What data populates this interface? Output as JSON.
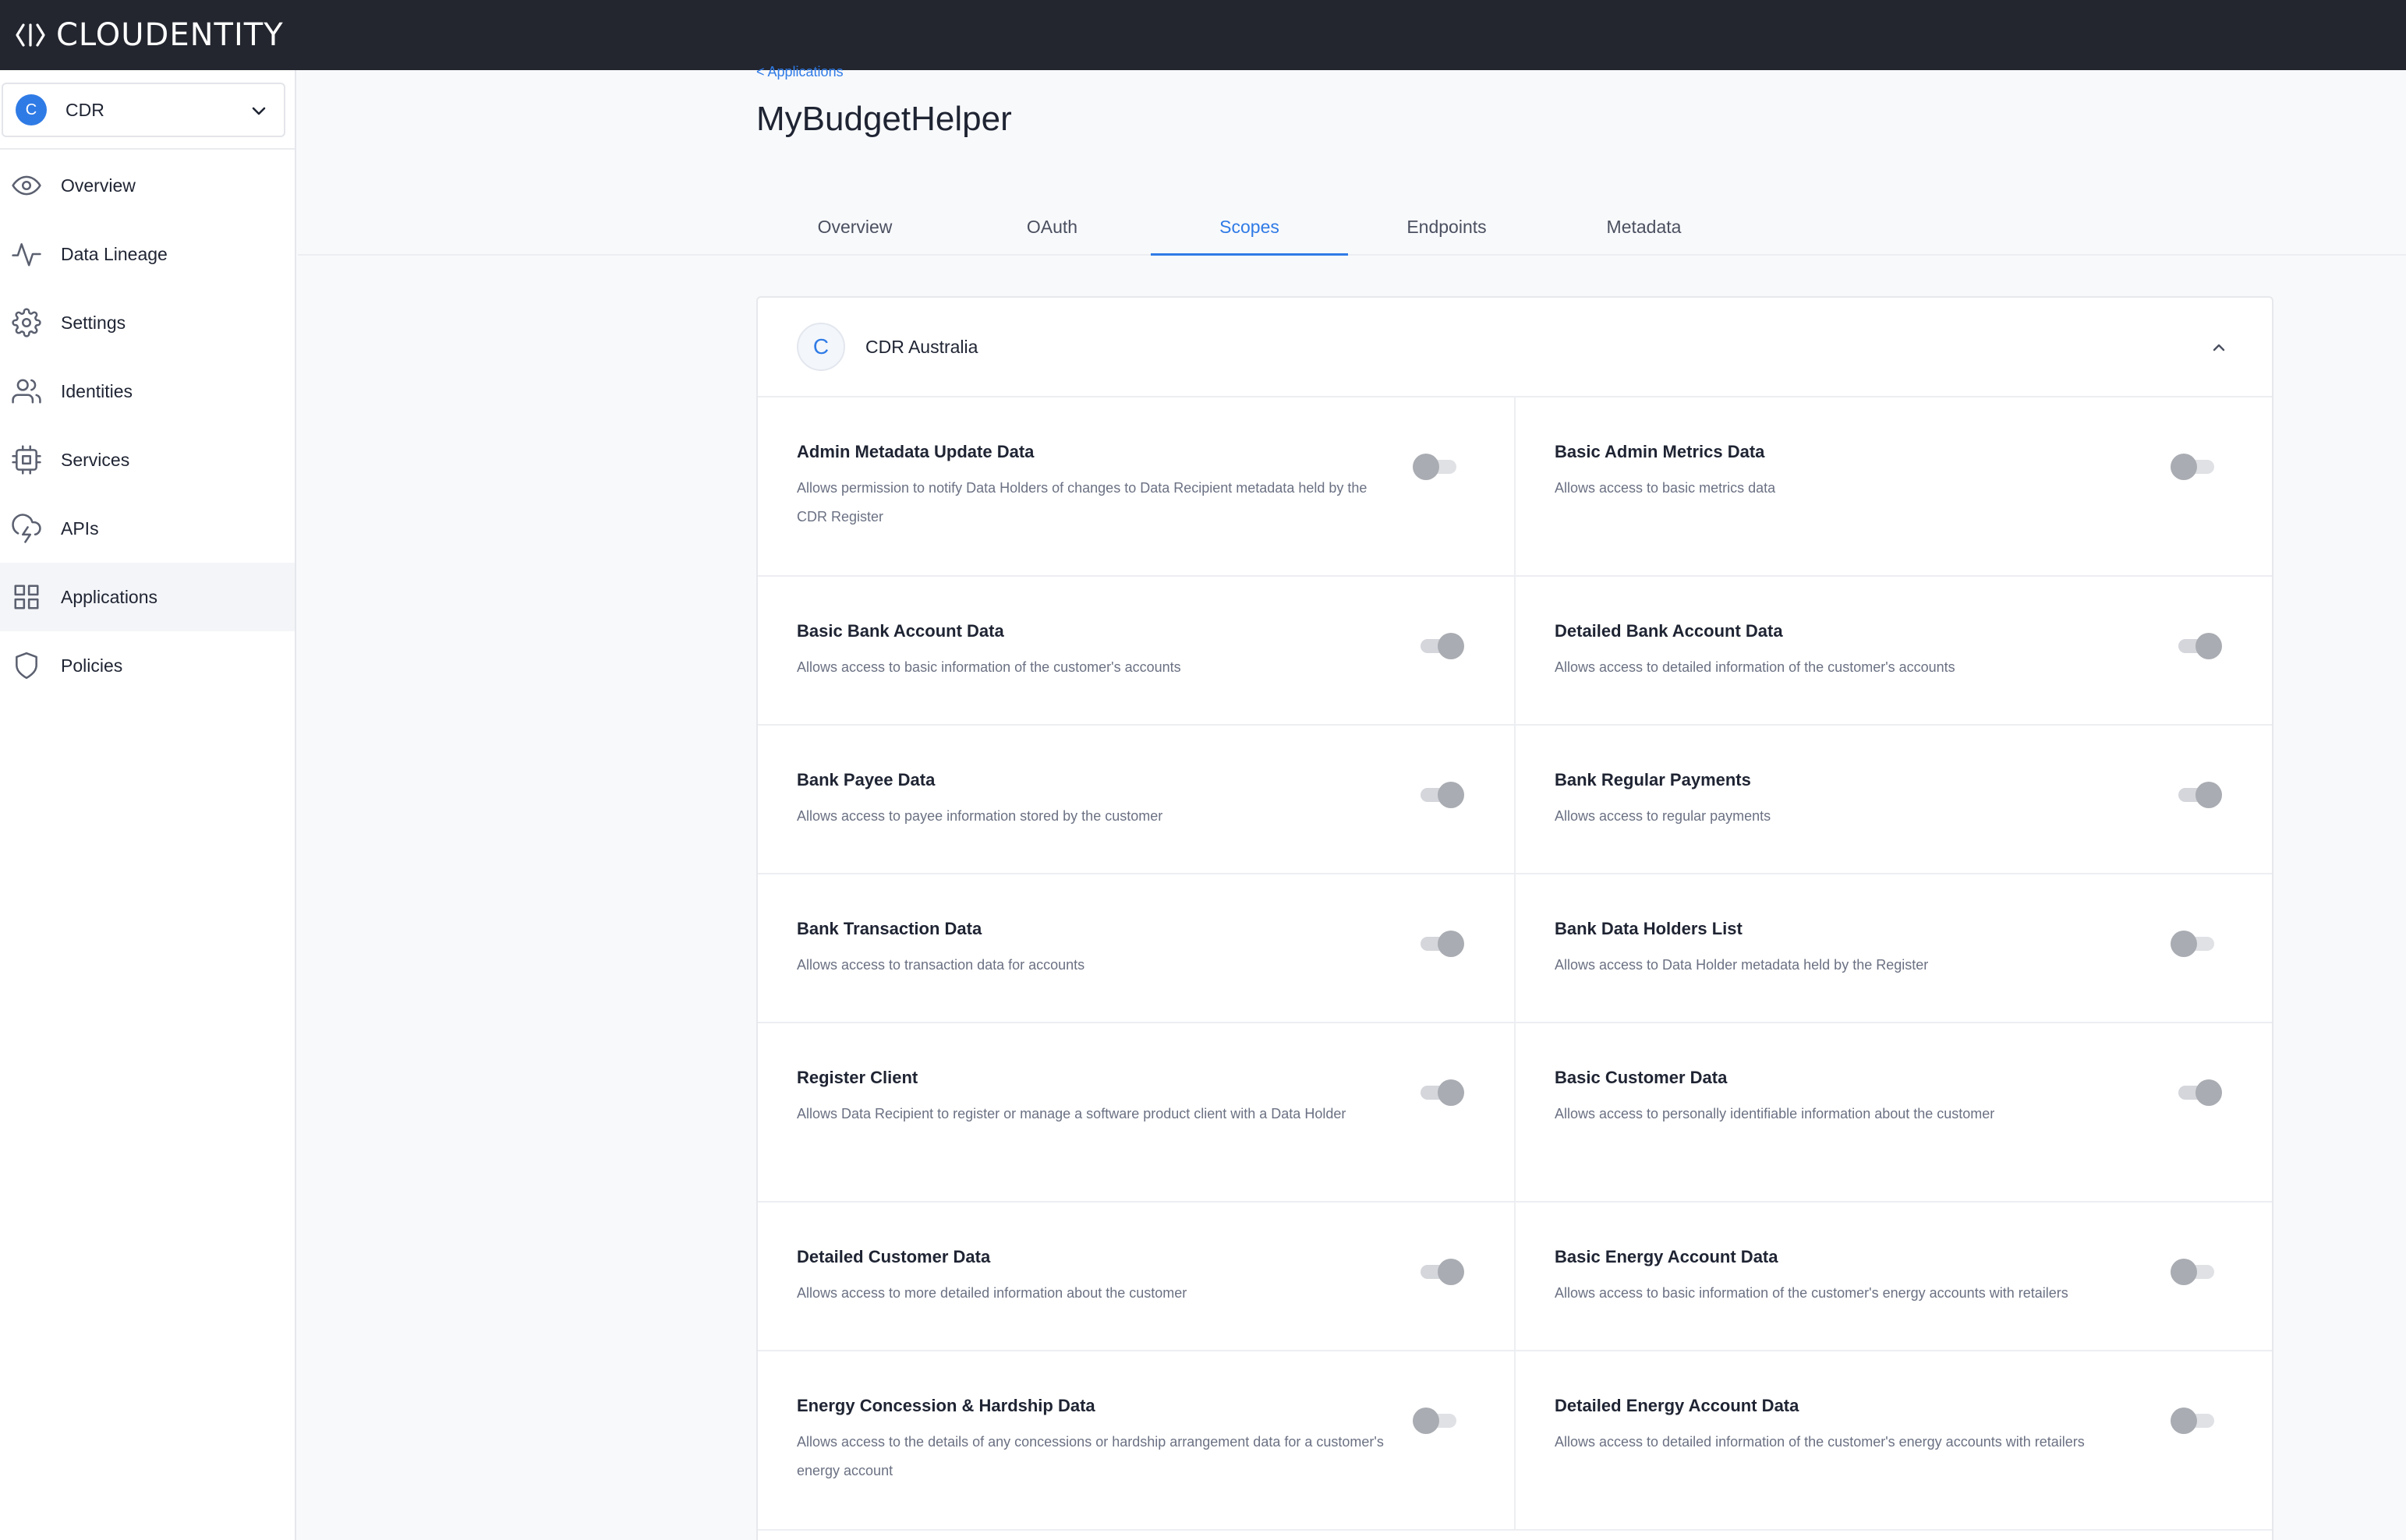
{
  "brand": {
    "name": "CLOUDENTITY"
  },
  "tenant": {
    "avatar": "C",
    "name": "CDR"
  },
  "nav": [
    {
      "label": "Overview",
      "icon": "eye-icon",
      "active": false
    },
    {
      "label": "Data Lineage",
      "icon": "activity-icon",
      "active": false
    },
    {
      "label": "Settings",
      "icon": "gear-icon",
      "active": false
    },
    {
      "label": "Identities",
      "icon": "users-icon",
      "active": false
    },
    {
      "label": "Services",
      "icon": "cpu-icon",
      "active": false
    },
    {
      "label": "APIs",
      "icon": "cloud-lightning-icon",
      "active": false
    },
    {
      "label": "Applications",
      "icon": "grid-icon",
      "active": true
    },
    {
      "label": "Policies",
      "icon": "shield-icon",
      "active": false
    }
  ],
  "header": {
    "breadcrumb": "< Applications",
    "title": "MyBudgetHelper",
    "tabs": [
      {
        "label": "Overview",
        "active": false
      },
      {
        "label": "OAuth",
        "active": false
      },
      {
        "label": "Scopes",
        "active": true
      },
      {
        "label": "Endpoints",
        "active": false
      },
      {
        "label": "Metadata",
        "active": false
      }
    ]
  },
  "card": {
    "avatar": "C",
    "title": "CDR Australia",
    "scopes": [
      {
        "name": "Admin Metadata Update Data",
        "desc": "Allows permission to notify Data Holders of changes to Data Recipient metadata held by the CDR Register",
        "enabled": false
      },
      {
        "name": "Basic Admin Metrics Data",
        "desc": "Allows access to basic metrics data",
        "enabled": false
      },
      {
        "name": "Basic Bank Account Data",
        "desc": "Allows access to basic information of the customer's accounts",
        "enabled": true
      },
      {
        "name": "Detailed Bank Account Data",
        "desc": "Allows access to detailed information of the customer's accounts",
        "enabled": true
      },
      {
        "name": "Bank Payee Data",
        "desc": "Allows access to payee information stored by the customer",
        "enabled": true
      },
      {
        "name": "Bank Regular Payments",
        "desc": "Allows access to regular payments",
        "enabled": true
      },
      {
        "name": "Bank Transaction Data",
        "desc": "Allows access to transaction data for accounts",
        "enabled": true
      },
      {
        "name": "Bank Data Holders List",
        "desc": "Allows access to Data Holder metadata held by the Register",
        "enabled": false
      },
      {
        "name": "Register Client",
        "desc": "Allows Data Recipient to register or manage a software product client with a Data Holder",
        "enabled": true
      },
      {
        "name": "Basic Customer Data",
        "desc": "Allows access to personally identifiable information about the customer",
        "enabled": true
      },
      {
        "name": "Detailed Customer Data",
        "desc": "Allows access to more detailed information about the customer",
        "enabled": true
      },
      {
        "name": "Basic Energy Account Data",
        "desc": "Allows access to basic information of the customer's energy accounts with retailers",
        "enabled": false
      },
      {
        "name": "Energy Concession & Hardship Data",
        "desc": "Allows access to the details of any concessions or hardship arrangement data for a customer's energy account",
        "enabled": false
      },
      {
        "name": "Detailed Energy Account Data",
        "desc": "Allows access to detailed information of the customer's energy accounts with retailers",
        "enabled": false
      }
    ]
  },
  "colors": {
    "accent": "#2f7be6",
    "topbar": "#23262f"
  }
}
